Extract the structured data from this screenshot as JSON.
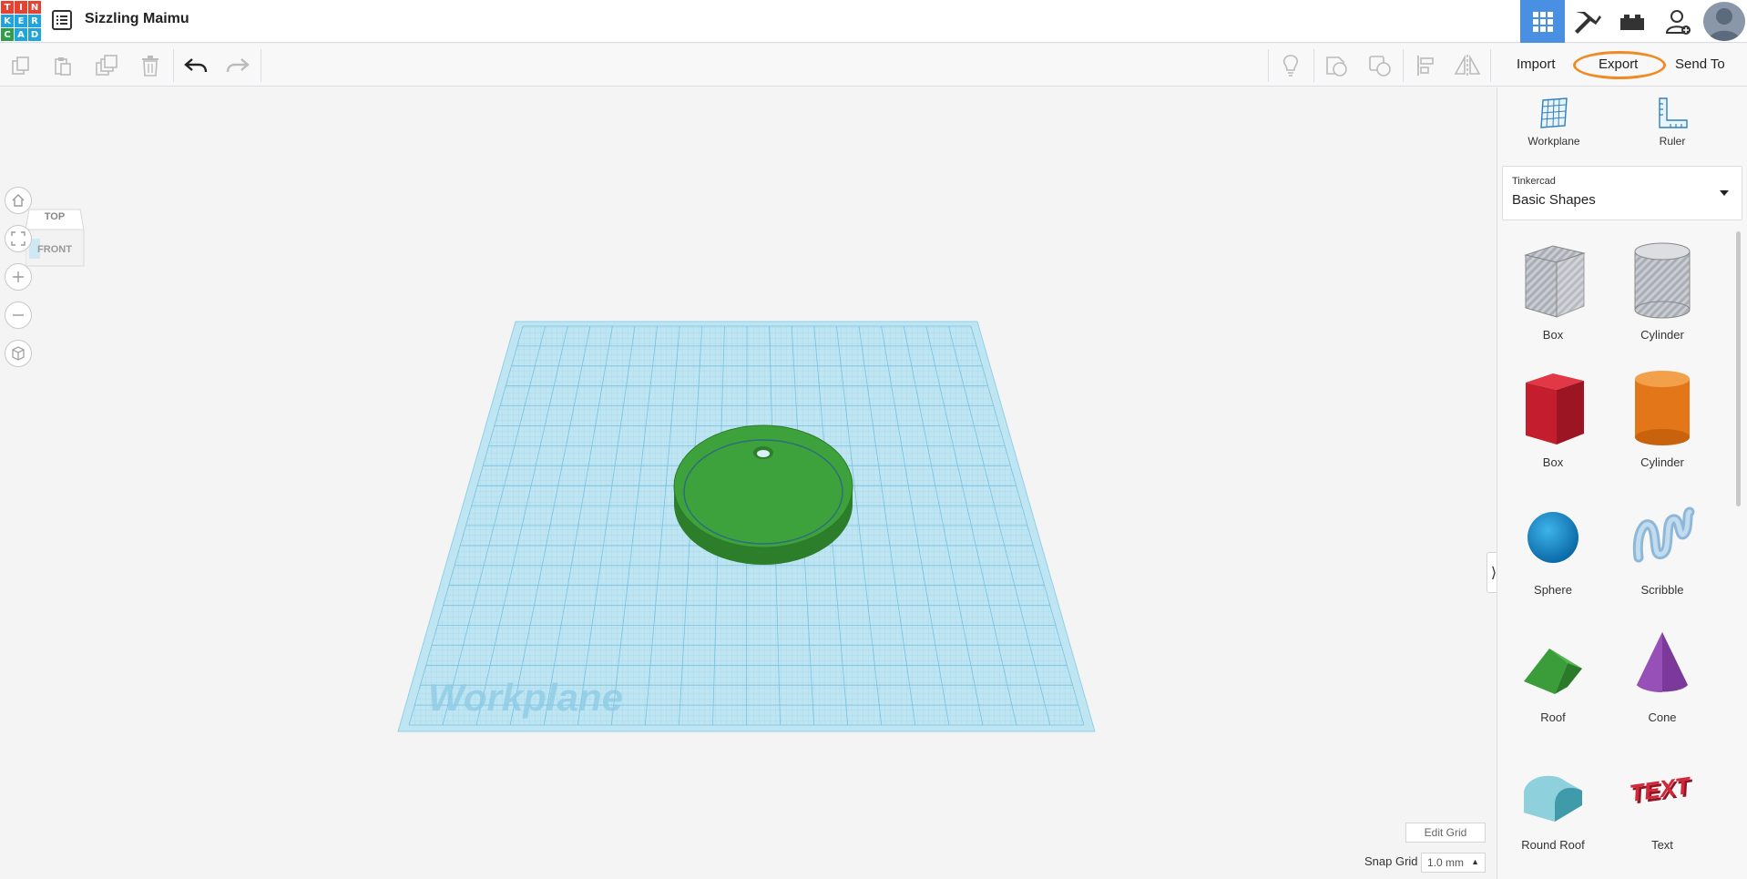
{
  "app": {
    "logo_letters": [
      "T",
      "I",
      "N",
      "K",
      "E",
      "R",
      "C",
      "A",
      "D"
    ],
    "logo_colors": [
      "#e8412f",
      "#e8412f",
      "#e8412f",
      "#1fa5dc",
      "#1fa5dc",
      "#1fa5dc",
      "#f3a62b",
      "#f3a62b",
      "#f3a62b"
    ],
    "project_title": "Sizzling Maimu"
  },
  "toolbar": {
    "import_label": "Import",
    "export_label": "Export",
    "send_to_label": "Send To",
    "highlight_color": "#f08a24"
  },
  "viewport": {
    "viewcube_top": "TOP",
    "viewcube_front": "FRONT",
    "workplane_label": "Workplane",
    "edit_grid_label": "Edit Grid",
    "snap_grid_label": "Snap Grid",
    "snap_grid_value": "1.0 mm"
  },
  "panel": {
    "workplane_label": "Workplane",
    "ruler_label": "Ruler",
    "library_source": "Tinkercad",
    "library_name": "Basic Shapes",
    "shapes": [
      {
        "label": "Box",
        "icon": "box-hole-icon"
      },
      {
        "label": "Cylinder",
        "icon": "cylinder-hole-icon"
      },
      {
        "label": "Box",
        "icon": "box-solid-icon"
      },
      {
        "label": "Cylinder",
        "icon": "cylinder-solid-icon"
      },
      {
        "label": "Sphere",
        "icon": "sphere-icon"
      },
      {
        "label": "Scribble",
        "icon": "scribble-icon"
      },
      {
        "label": "Roof",
        "icon": "roof-icon"
      },
      {
        "label": "Cone",
        "icon": "cone-icon"
      },
      {
        "label": "Round Roof",
        "icon": "round-roof-icon"
      },
      {
        "label": "Text",
        "icon": "text-shape-icon"
      }
    ]
  },
  "colors": {
    "accent": "#4a90e2",
    "workplane": "#a9dcee",
    "object": "#3da23b"
  }
}
